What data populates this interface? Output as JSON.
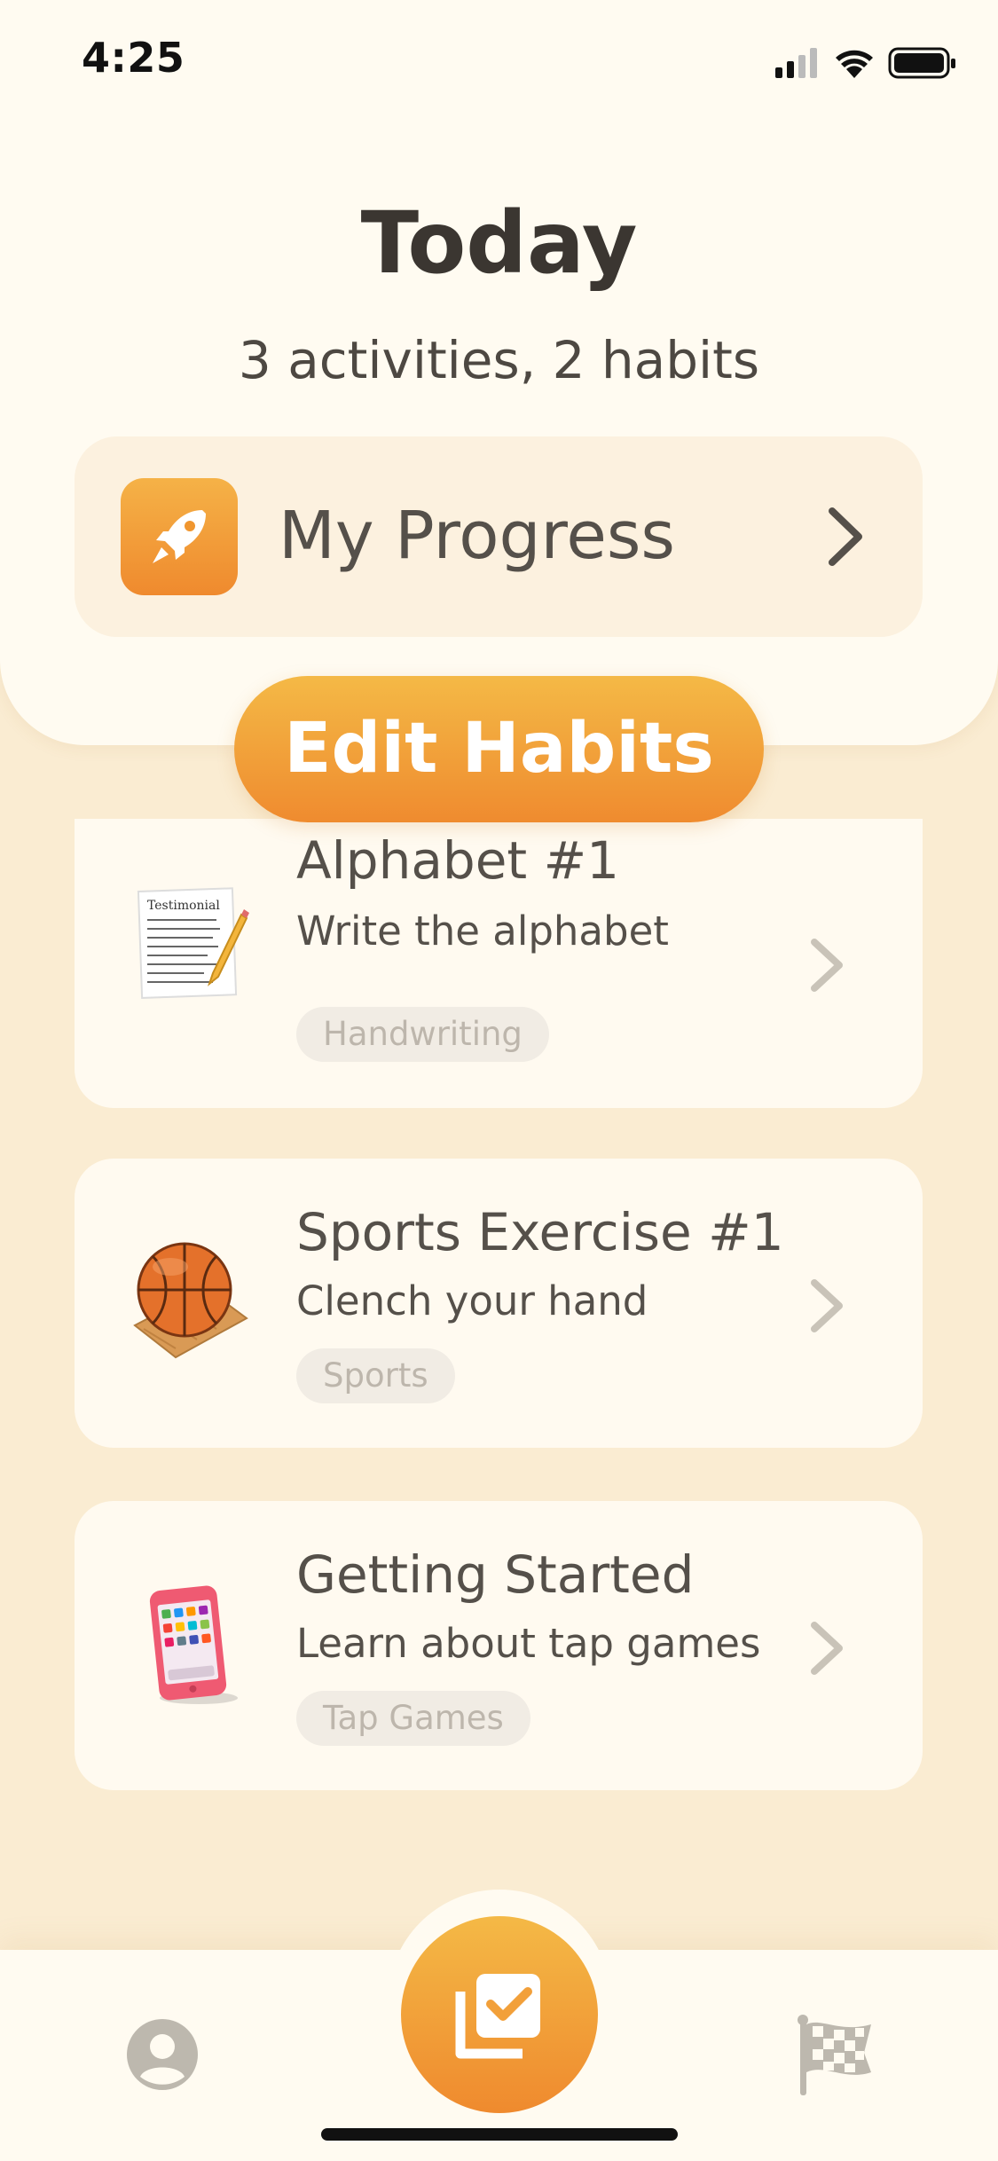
{
  "status_bar": {
    "time": "4:25"
  },
  "header": {
    "title": "Today",
    "subtitle": "3 activities, 2 habits"
  },
  "progress": {
    "label": "My Progress",
    "icon": "rocket-icon"
  },
  "edit_button": {
    "label": "Edit Habits"
  },
  "activities": [
    {
      "title": "Alphabet #1",
      "description": "Write the alphabet",
      "tag": "Handwriting",
      "icon": "notepad-icon"
    },
    {
      "title": "Sports Exercise #1",
      "description": "Clench your hand",
      "tag": "Sports",
      "icon": "basketball-icon"
    },
    {
      "title": "Getting Started",
      "description": "Learn about tap games",
      "tag": "Tap Games",
      "icon": "phone-icon"
    }
  ],
  "tabbar": {
    "left": "profile-icon",
    "center": "checklist-icon",
    "right": "flag-icon"
  },
  "colors": {
    "background": "#faecd2",
    "card": "#fffaf0",
    "accent_top": "#f4b946",
    "accent_bottom": "#ef8a2e",
    "text": "#55504a"
  }
}
